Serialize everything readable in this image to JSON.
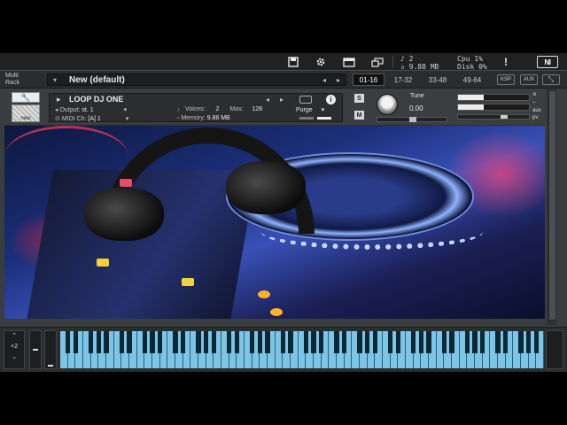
{
  "toolbar": {
    "save_icon": "disk-icon",
    "settings_icon": "gear-icon",
    "rack_view_icon": "rack-view-icon",
    "minimize_icon": "minimize-icon",
    "midi_count": "2",
    "memory": "9.88 MB",
    "cpu_label": "Cpu",
    "cpu_value": "1%",
    "disk_label": "Disk",
    "disk_value": "0%",
    "warning": "!",
    "logo": "NI"
  },
  "rack": {
    "multi_label_1": "Multi",
    "multi_label_2": "Rack",
    "preset_name": "New (default)",
    "ranges": [
      "01-16",
      "17-32",
      "33-48",
      "49-64"
    ],
    "active_range": "01-16",
    "ksp_label": "KSP",
    "aux_label": "AUX"
  },
  "instrument": {
    "name": "LOOP DJ ONE",
    "output_label": "Output:",
    "output_value": "st. 1",
    "voices_label": "Voices:",
    "voices_value": "2",
    "max_label": "Max:",
    "max_value": "128",
    "purge_label": "Purge",
    "midi_label": "MIDI Ch:",
    "midi_value": "[A] 1",
    "memory_label": "Memory:",
    "memory_value": "9.88 MB",
    "solo": "S",
    "mute": "M",
    "tune_label": "Tune",
    "tune_value": "0.00",
    "aux_side": "aux",
    "pv_side": "pv",
    "close_glyph": "×",
    "icon_label": "new"
  },
  "keyboard": {
    "octave_value": "+2",
    "white_keys": 63,
    "accent_color": "#7cc5e6"
  }
}
